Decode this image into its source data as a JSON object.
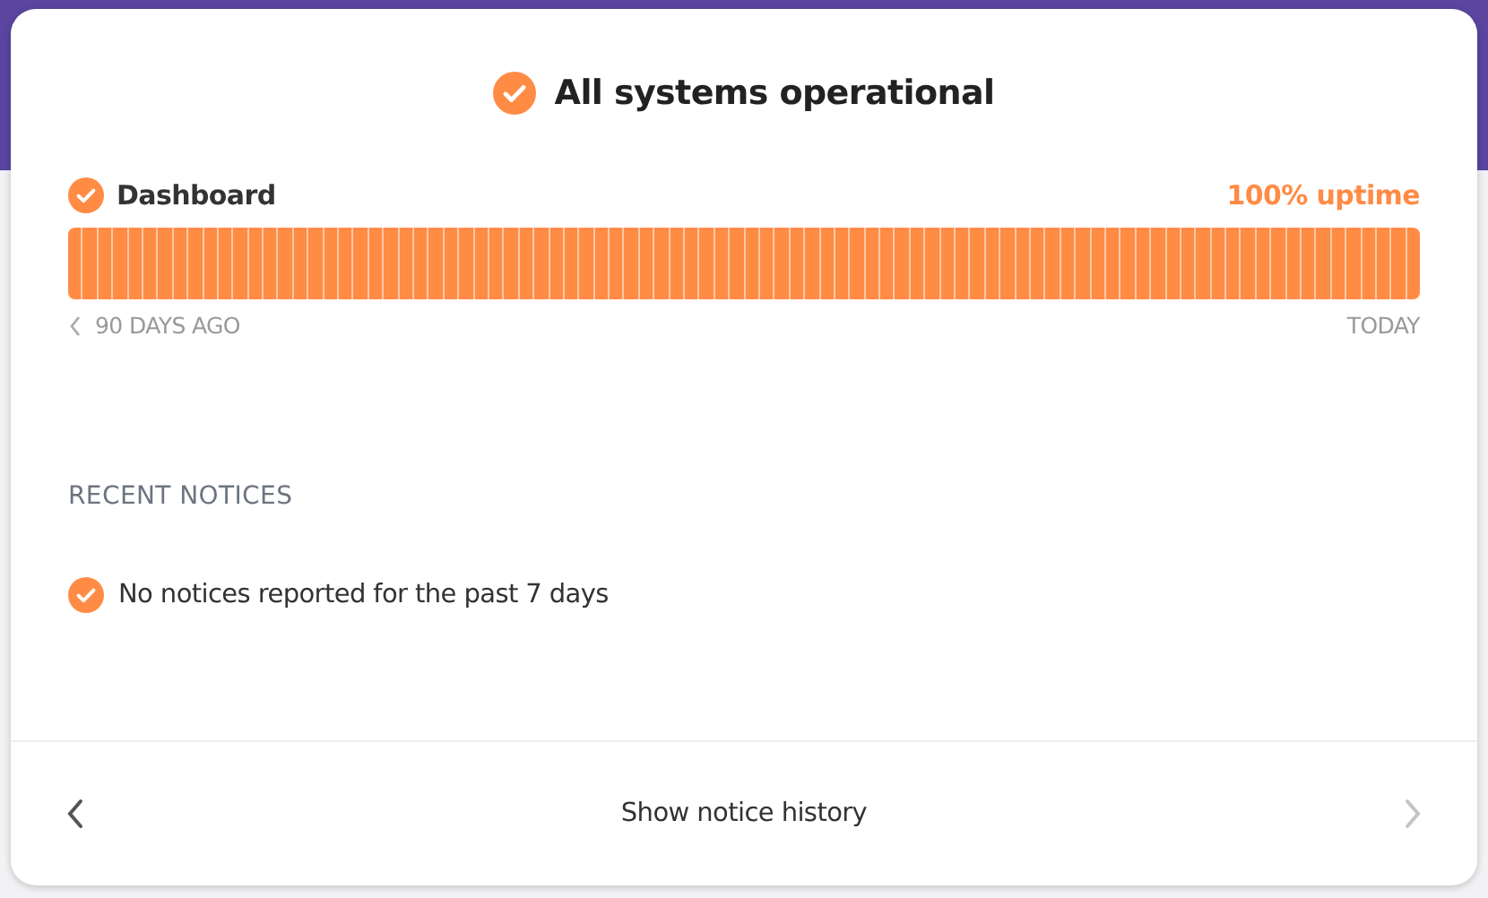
{
  "status": {
    "title": "All systems operational"
  },
  "monitors": [
    {
      "name": "Dashboard",
      "uptime": "100% uptime",
      "range_start": "90 DAYS AGO",
      "range_end": "TODAY"
    }
  ],
  "notices": {
    "heading": "RECENT NOTICES",
    "message": "No notices reported for the past 7 days"
  },
  "footer": {
    "label": "Show notice history",
    "prev_disabled": false,
    "next_disabled": true
  }
}
